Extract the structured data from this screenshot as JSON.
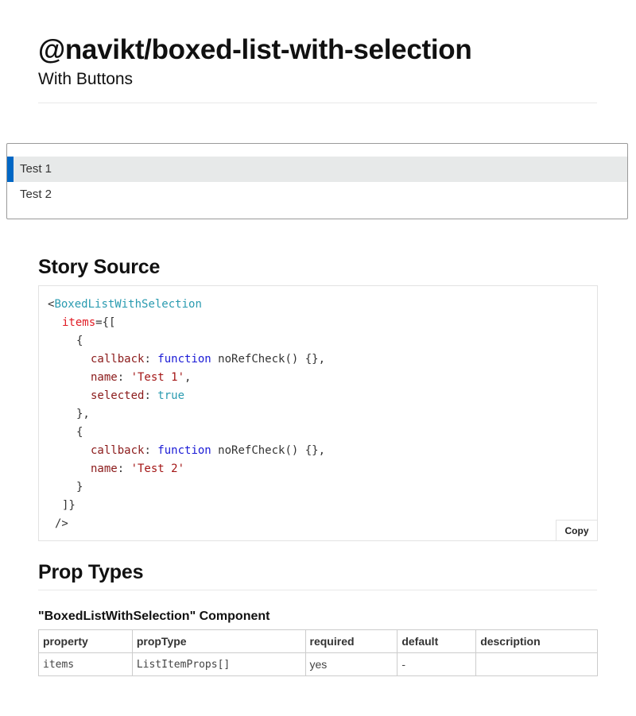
{
  "header": {
    "title": "@navikt/boxed-list-with-selection",
    "subtitle": "With Buttons"
  },
  "preview": {
    "items": [
      {
        "label": "Test 1",
        "selected": true
      },
      {
        "label": "Test 2",
        "selected": false
      }
    ],
    "accent_color": "#0067c5",
    "selected_bg": "#e7e9e9"
  },
  "story_source": {
    "heading": "Story Source",
    "copy_label": "Copy",
    "code": {
      "component": "BoxedListWithSelection",
      "items_attr": "items",
      "callback_key": "callback",
      "function_kw": "function",
      "callback_value": "noRefCheck() {},",
      "name_key": "name",
      "name_1": "'Test 1'",
      "name_2": "'Test 2'",
      "selected_key": "selected",
      "selected_value": "true"
    }
  },
  "prop_types": {
    "heading": "Prop Types",
    "component_title": "\"BoxedListWithSelection\" Component",
    "columns": [
      "property",
      "propType",
      "required",
      "default",
      "description"
    ],
    "rows": [
      {
        "property": "items",
        "propType": "ListItemProps[]",
        "required": "yes",
        "default": "-",
        "description": ""
      }
    ]
  }
}
